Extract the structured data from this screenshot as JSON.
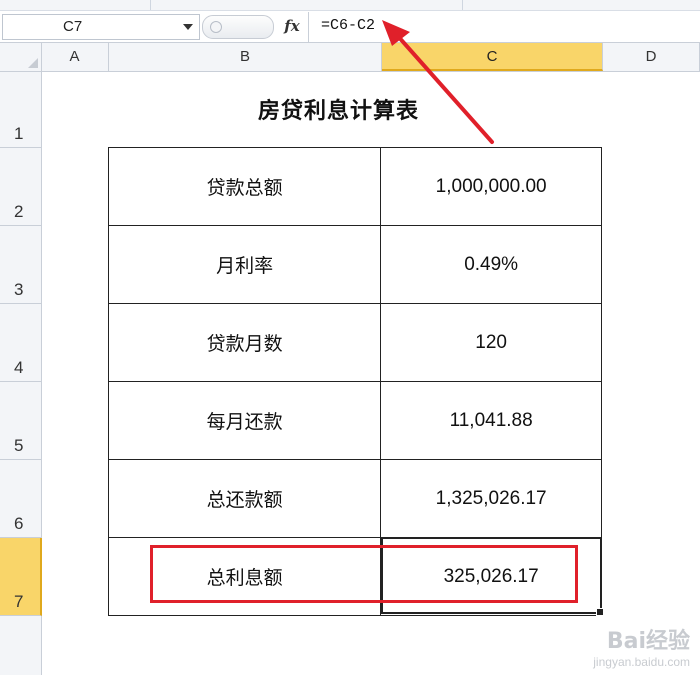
{
  "formula_bar": {
    "name_box": "C7",
    "fx_label": "fx",
    "formula": "=C6-C2"
  },
  "columns": [
    "A",
    "B",
    "C",
    "D"
  ],
  "active_column": "C",
  "rows": [
    "1",
    "2",
    "3",
    "4",
    "5",
    "6",
    "7"
  ],
  "active_row": "7",
  "sheet": {
    "title": "房贷利息计算表",
    "table": [
      {
        "label": "贷款总额",
        "value": "1,000,000.00"
      },
      {
        "label": "月利率",
        "value": "0.49%"
      },
      {
        "label": "贷款月数",
        "value": "120"
      },
      {
        "label": "每月还款",
        "value": "11,041.88"
      },
      {
        "label": "总还款额",
        "value": "1,325,026.17"
      },
      {
        "label": "总利息额",
        "value": "325,026.17"
      }
    ]
  },
  "annotation": {
    "highlight_color": "#e0202a",
    "arrow_color": "#e0202a"
  },
  "watermark": {
    "brand": "Bai经验",
    "url": "jingyan.baidu.com"
  }
}
